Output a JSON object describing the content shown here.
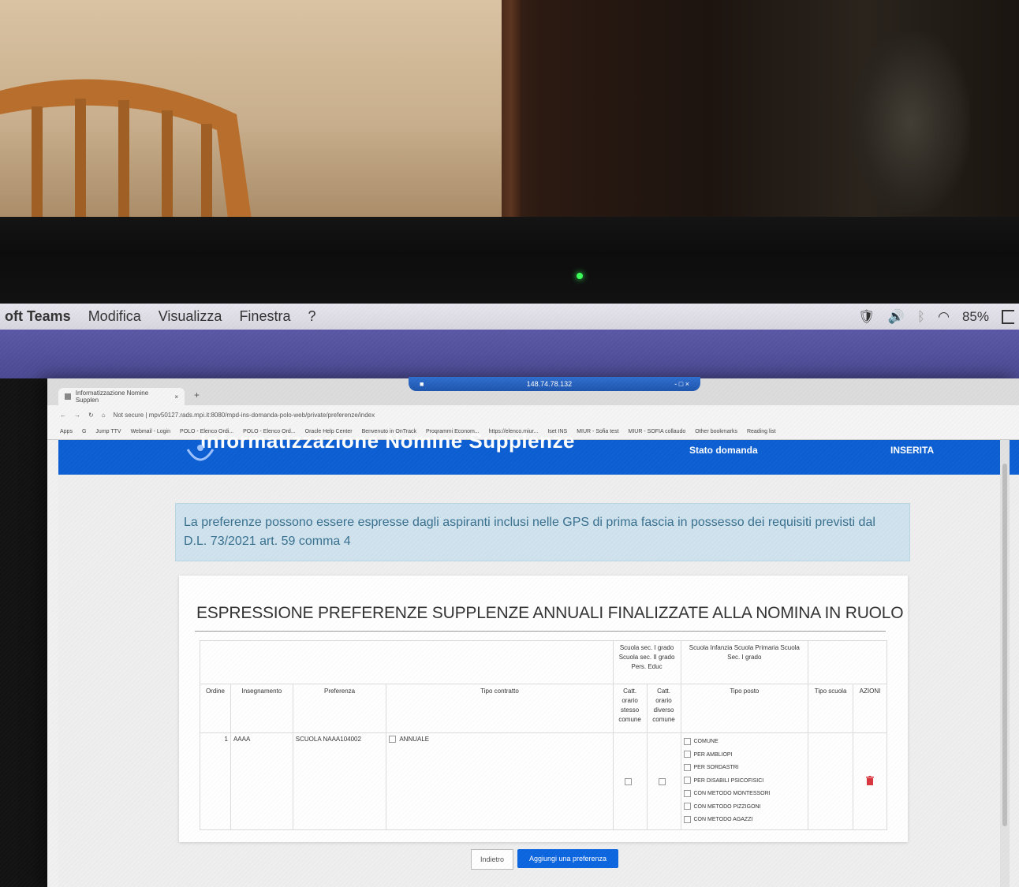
{
  "menubar": {
    "app_name": "oft Teams",
    "items": [
      "Modifica",
      "Visualizza",
      "Finestra",
      "?"
    ],
    "battery": "85%"
  },
  "browser": {
    "tab_title": "Informatizzazione Nomine Supplen",
    "address": "Not secure | mpv50127.rads.mpi.it:8080/mpd-ins-domanda-polo-web/private/preferenze/index",
    "remote_title": "148.74.78.132",
    "bookmarks": [
      "Apps",
      "G",
      "Jump TTV",
      "Webmail - Login",
      "POLO - Elenco Ordi...",
      "POLO - Elenco Ord...",
      "Oracle Help Center",
      "Benvenuto in OnTrack",
      "Programmi Econom...",
      "https://elenco.miur...",
      "Iset INS",
      "MIUR - Sofia test",
      "MIUR - SOFIA collaudo",
      "Other bookmarks",
      "Reading list"
    ]
  },
  "site": {
    "title": "Informatizzazione Nomine Supplenze",
    "nav_stato": "Stato domanda",
    "nav_inserita": "INSERITA"
  },
  "info_text": "La preferenze possono essere espresse dagli aspiranti inclusi nelle GPS di prima fascia in possesso dei requisiti previsti dal D.L. 73/2021 art. 59 comma 4",
  "section_title": "ESPRESSIONE PREFERENZE SUPPLENZE ANNUALI FINALIZZATE ALLA NOMINA IN RUOLO",
  "table": {
    "group_sec": "Scuola sec. I grado Scuola sec. II grado Pers. Educ",
    "group_inf": "Scuola Infanzia Scuola Primaria Scuola Sec. I grado",
    "headers": {
      "ordine": "Ordine",
      "insegnamento": "Insegnamento",
      "preferenza": "Preferenza",
      "tipo_contratto": "Tipo contratto",
      "catt_stesso": "Catt. orario stesso comune",
      "catt_diverso": "Catt. orario diverso comune",
      "tipo_posto": "Tipo posto",
      "tipo_scuola": "Tipo scuola",
      "azioni": "AZIONI"
    },
    "row": {
      "ordine": "1",
      "insegnamento": "AAAA",
      "preferenza": "SCUOLA NAAA104002",
      "tipo_contratto": "ANNUALE",
      "tipo_posto_options": [
        "COMUNE",
        "PER AMBLIOPI",
        "PER SORDASTRI",
        "PER DISABILI PSICOFISICI",
        "CON METODO MONTESSORI",
        "CON METODO PIZZIGONI",
        "CON METODO AGAZZI"
      ]
    }
  },
  "buttons": {
    "indietro": "Indietro",
    "aggiungi": "Aggiungi una preferenza"
  },
  "colors": {
    "header_blue": "#0c5fd3",
    "teams_purple": "#4b4992",
    "info_bg": "#cfe3ee",
    "delete_red": "#d9363e"
  }
}
